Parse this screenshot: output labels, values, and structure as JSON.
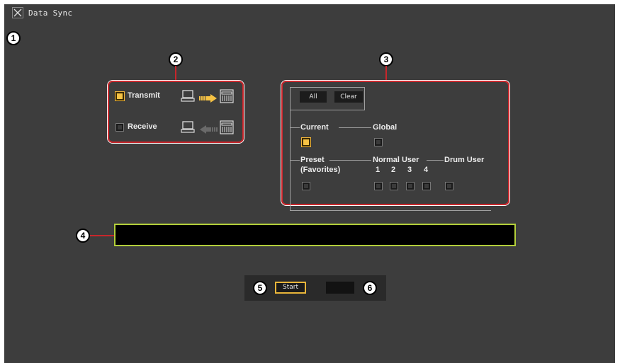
{
  "window": {
    "title": "Data Sync"
  },
  "callouts": [
    "1",
    "2",
    "3",
    "4",
    "5",
    "6"
  ],
  "direction": {
    "transmit": {
      "label": "Transmit",
      "checked": true
    },
    "receive": {
      "label": "Receive",
      "checked": false
    }
  },
  "target": {
    "all_label": "All",
    "clear_label": "Clear",
    "current_label": "Current",
    "global_label": "Global",
    "preset_label": "Preset",
    "preset_sub": "(Favorites)",
    "normal_user_label": "Normal User",
    "drum_user_label": "Drum User",
    "normal_numbers": [
      "1",
      "2",
      "3",
      "4"
    ],
    "current_checked": true,
    "global_checked": false
  },
  "actions": {
    "start_label": "Start"
  },
  "colors": {
    "accent_orange": "#f6c244",
    "message_border": "#b3cf3a",
    "callout_red": "#c8262b"
  },
  "icons": [
    "close-icon",
    "computer-icon",
    "keyboard-icon",
    "arrow-right-icon",
    "arrow-left-icon"
  ]
}
